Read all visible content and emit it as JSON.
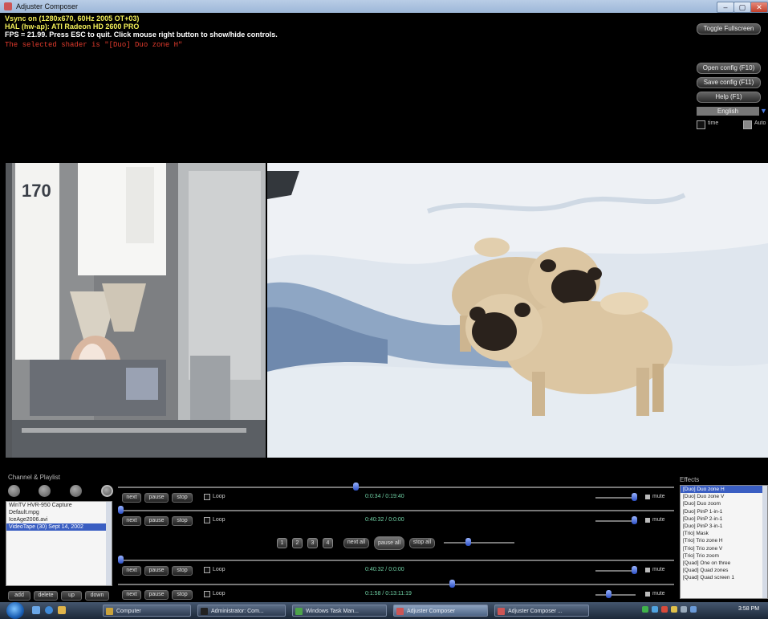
{
  "window": {
    "title": "Adjuster Composer",
    "min": "–",
    "max": "▢",
    "close": "✕"
  },
  "info": {
    "line1": "Vsync on (1280x670, 60Hz 2005 OT+03)",
    "line2": "HAL (hw-ap): ATI Radeon HD 2600 PRO",
    "line3": "FPS = 21.99. Press ESC to quit. Click mouse right button to show/hide controls.",
    "line4": "The selected shader is \"[Duo] Duo zone H\""
  },
  "controls": {
    "toggle_fullscreen": "Toggle Fullscreen",
    "open_config": "Open config (F10)",
    "save_config": "Save config (F11)",
    "help": "Help (F1)",
    "language": "English",
    "lang_arrow": "▼",
    "check1_label": "time",
    "check2_label": "Auto"
  },
  "video": {
    "overlay_number": "170"
  },
  "channel_panel": {
    "title": "Channel & Playlist"
  },
  "playlist": [
    {
      "label": "WinTV HVR-950 Capture",
      "selected": false
    },
    {
      "label": "Default.mpg",
      "selected": false
    },
    {
      "label": "IceAge2006.avi",
      "selected": false
    },
    {
      "label": "VideoTape (30) Sept 14, 2002",
      "selected": true
    }
  ],
  "playlist_buttons": {
    "add": "add",
    "delete": "delete",
    "up": "up",
    "down": "down"
  },
  "tracks": [
    {
      "next": "next",
      "pause": "pause",
      "stop": "stop",
      "loop": "Loop",
      "time": "0:0:34 / 0:19:40",
      "mute": "mute",
      "progress": 0.45
    },
    {
      "next": "next",
      "pause": "pause",
      "stop": "stop",
      "loop": "Loop",
      "time": "0:40:32 / 0:0:00",
      "mute": "mute",
      "progress": 0.0
    },
    {
      "next": "next",
      "pause": "pause",
      "stop": "stop",
      "loop": "Loop",
      "time": "0:40:32 / 0:0:00",
      "mute": "mute",
      "progress": 0.0
    },
    {
      "next": "next",
      "pause": "pause",
      "stop": "stop",
      "loop": "Loop",
      "time": "0:1:58 / 0:13:11:19",
      "mute": "mute",
      "progress": 0.6
    }
  ],
  "global_controls": {
    "n1": "1",
    "n2": "2",
    "n3": "3",
    "n4": "4",
    "next_all": "next all",
    "pause_all": "pause all",
    "stop_all": "stop all"
  },
  "effects": {
    "title": "Effects",
    "items": [
      {
        "label": "[Duo] Duo zone H",
        "selected": true
      },
      {
        "label": "[Duo] Duo zone V",
        "selected": false
      },
      {
        "label": "[Duo] Duo zoom",
        "selected": false
      },
      {
        "label": "[Duo] PinP 1-in-1",
        "selected": false
      },
      {
        "label": "[Duo] PinP 2-in-1",
        "selected": false
      },
      {
        "label": "[Duo] PinP 3-in-1",
        "selected": false
      },
      {
        "label": "[Trio] Mask",
        "selected": false
      },
      {
        "label": "[Trio] Trio zone H",
        "selected": false
      },
      {
        "label": "[Trio] Trio zone V",
        "selected": false
      },
      {
        "label": "[Trio] Trio zoom",
        "selected": false
      },
      {
        "label": "[Quad] One on three",
        "selected": false
      },
      {
        "label": "[Quad] Quad zones",
        "selected": false
      },
      {
        "label": "[Quad] Quad screen 1",
        "selected": false
      }
    ]
  },
  "taskbar": {
    "items": [
      {
        "label": "Computer",
        "active": false
      },
      {
        "label": "Administrator: Com...",
        "active": false
      },
      {
        "label": "Windows Task Man...",
        "active": false
      },
      {
        "label": "Adjuster Composer",
        "active": true
      },
      {
        "label": "Adjuster Composer ...",
        "active": false
      }
    ],
    "clock": "3:58 PM"
  }
}
